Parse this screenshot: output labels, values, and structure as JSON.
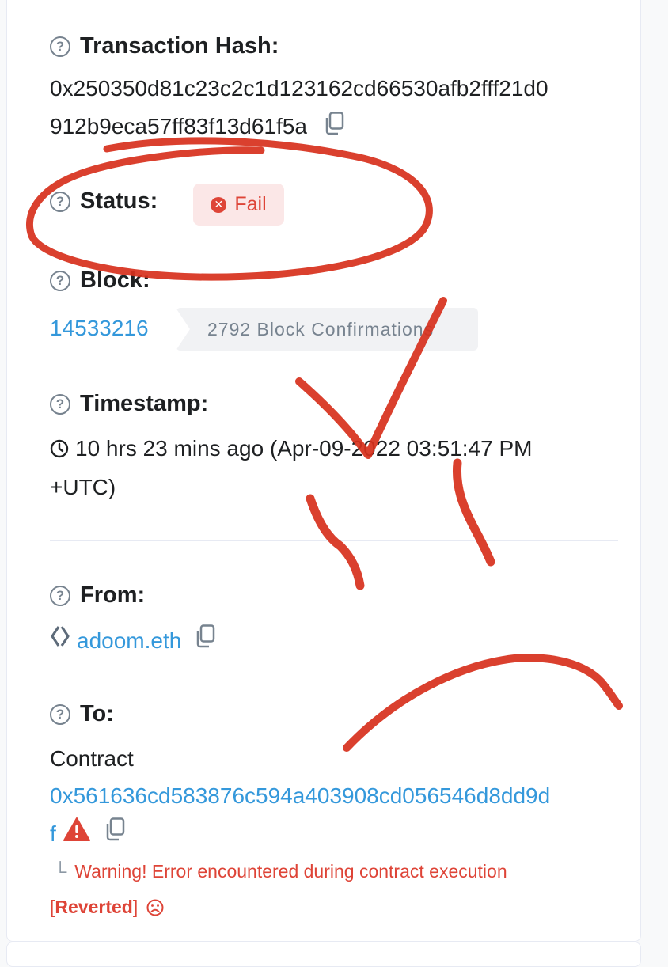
{
  "tx_hash": {
    "label": "Transaction Hash:",
    "line1": "0x250350d81c23c2c1d123162cd66530afb2fff21d0",
    "line2": "912b9eca57ff83f13d61f5a"
  },
  "status": {
    "label": "Status:",
    "value": "Fail"
  },
  "block": {
    "label": "Block:",
    "number": "14533216",
    "confirmations": "2792 Block Confirmations"
  },
  "timestamp": {
    "label": "Timestamp:",
    "line1": "10 hrs 23 mins ago (Apr-09-2022 03:51:47 PM",
    "line2": "+UTC)"
  },
  "from": {
    "label": "From:",
    "value": "adoom.eth"
  },
  "to": {
    "label": "To:",
    "type": "Contract",
    "address_line1": "0x561636cd583876c594a403908cd056546d8dd9d",
    "address_line2": "f",
    "warning": "Warning! Error encountered during contract execution",
    "reverted_open": "[",
    "reverted": "Reverted",
    "reverted_close": "]"
  },
  "icons": {
    "help": "question-circle-icon",
    "copy": "copy-icon",
    "fail": "x-circle-icon",
    "clock": "clock-icon",
    "ens": "ens-logo-icon",
    "warning": "warning-triangle-icon",
    "sad": "frown-icon"
  },
  "colors": {
    "link": "#3498db",
    "danger": "#de4437",
    "fail_bg": "#fbe7e7",
    "muted": "#77838f",
    "scribble": "#d7301c"
  }
}
